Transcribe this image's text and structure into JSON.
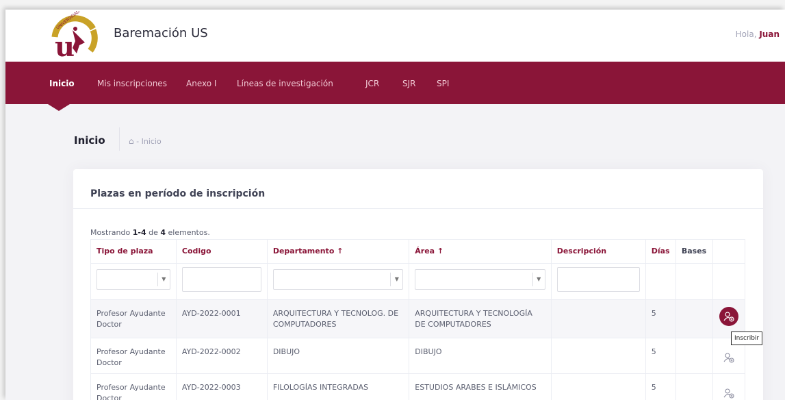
{
  "header": {
    "app_title": "Baremación US",
    "greeting_prefix": "Hola,",
    "user_name": "Juan",
    "logo": {
      "name": "universidad-de-sevilla-logo",
      "text": "UNIVERSIDAD DE SEVILLA"
    }
  },
  "nav": {
    "items": [
      {
        "label": "Inicio",
        "active": true
      },
      {
        "label": "Mis inscripciones"
      },
      {
        "label": "Anexo I"
      },
      {
        "label": "Líneas de investigación"
      },
      {
        "label": "JCR"
      },
      {
        "label": "SJR"
      },
      {
        "label": "SPI"
      }
    ]
  },
  "subheader": {
    "title": "Inicio",
    "breadcrumb_sep": "-",
    "breadcrumb": "Inicio",
    "home_icon": "home-icon"
  },
  "card": {
    "title": "Plazas en período de inscripción",
    "summary": {
      "prefix": "Mostrando",
      "range": "1-4",
      "middle": "de",
      "total": "4",
      "suffix": "elementos."
    },
    "columns": [
      "Tipo de plaza",
      "Codigo",
      "Departamento ↑",
      "Área ↑",
      "Descripción",
      "Días",
      "Bases"
    ],
    "rows": [
      {
        "tipo": "Profesor Ayudante Doctor",
        "codigo": "AYD-2022-0001",
        "departamento": "ARQUITECTURA Y TECNOLOG. DE COMPUTADORES",
        "area": "ARQUITECTURA Y TECNOLOGÍA DE COMPUTADORES",
        "descripcion": "",
        "dias": "5",
        "bases": ""
      },
      {
        "tipo": "Profesor Ayudante Doctor",
        "codigo": "AYD-2022-0002",
        "departamento": "DIBUJO",
        "area": "DIBUJO",
        "descripcion": "",
        "dias": "5",
        "bases": ""
      },
      {
        "tipo": "Profesor Ayudante Doctor",
        "codigo": "AYD-2022-0003",
        "departamento": "FILOLOGÍAS INTEGRADAS",
        "area": "ESTUDIOS ARABES E ISLÁMICOS",
        "descripcion": "",
        "dias": "5",
        "bases": ""
      }
    ],
    "action_icon": "add-user-icon",
    "tooltip": "Inscribir"
  },
  "colors": {
    "brand": "#8a1538",
    "muted": "#a2a3b7",
    "text": "#595d6e"
  }
}
